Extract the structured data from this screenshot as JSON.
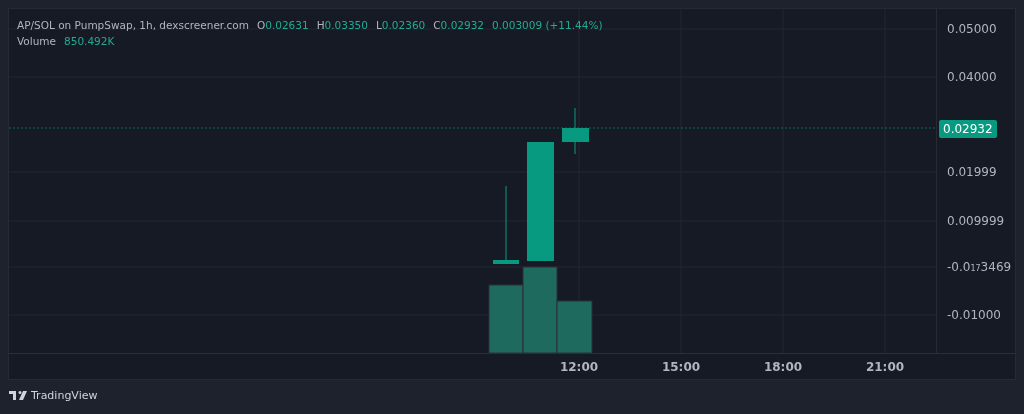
{
  "legend": {
    "title": "AP/SOL on PumpSwap, 1h, dexscreener.com",
    "ohlc": [
      {
        "label": "O",
        "value": "0.02631"
      },
      {
        "label": "H",
        "value": "0.03350"
      },
      {
        "label": "L",
        "value": "0.02360"
      },
      {
        "label": "C",
        "value": "0.02932"
      }
    ],
    "change": "0.003009 (+11.44%)",
    "volume": {
      "label": "Volume",
      "value": "850.492K"
    }
  },
  "price_axis": {
    "labels": [
      "0.05000",
      "0.04000",
      "0.01999",
      "0.009999",
      "-0.0$_{17}$3469",
      "-0.01000"
    ],
    "last_price": "0.02932"
  },
  "time_axis": {
    "labels": [
      "12:00",
      "15:00",
      "18:00",
      "21:00"
    ]
  },
  "footer": {
    "brand": "TradingView"
  }
}
